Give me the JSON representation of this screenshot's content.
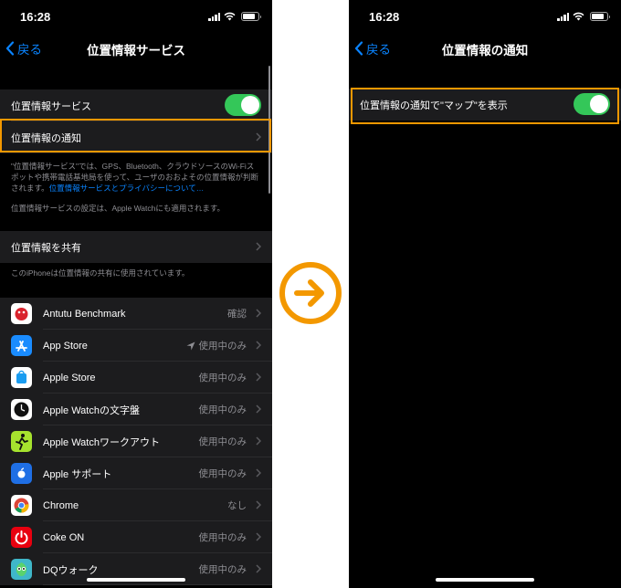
{
  "left": {
    "status": {
      "time": "16:28"
    },
    "nav": {
      "back": "戻る",
      "title": "位置情報サービス"
    },
    "location_services": {
      "label": "位置情報サービス",
      "enabled": true
    },
    "location_alerts": {
      "label": "位置情報の通知"
    },
    "footer1": {
      "text": "\"位置情報サービス\"では、GPS、Bluetooth、クラウドソースのWi-Fiスポットや携帯電話基地局を使って、ユーザのおおよその位置情報が判断されます。",
      "link": "位置情報サービスとプライバシーについて…"
    },
    "footer2": "位置情報サービスの設定は、Apple Watchにも適用されます。",
    "share": {
      "label": "位置情報を共有"
    },
    "footer3": "このiPhoneは位置情報の共有に使用されています。",
    "apps": [
      {
        "name": "Antutu Benchmark",
        "value": "確認",
        "icon": "antutu-icon",
        "color": "#ffffff"
      },
      {
        "name": "App Store",
        "value": "使用中のみ",
        "icon": "app-store-icon",
        "color": "#1a8cff",
        "arrow": true
      },
      {
        "name": "Apple Store",
        "value": "使用中のみ",
        "icon": "apple-store-icon",
        "color": "#ffffff"
      },
      {
        "name": "Apple Watchの文字盤",
        "value": "使用中のみ",
        "icon": "watch-face-icon",
        "color": "#ffffff"
      },
      {
        "name": "Apple Watchワークアウト",
        "value": "使用中のみ",
        "icon": "workout-icon",
        "color": "#a6e22e"
      },
      {
        "name": "Apple サポート",
        "value": "使用中のみ",
        "icon": "apple-support-icon",
        "color": "#1f6fe5"
      },
      {
        "name": "Chrome",
        "value": "なし",
        "icon": "chrome-icon",
        "color": "#ffffff"
      },
      {
        "name": "Coke ON",
        "value": "使用中のみ",
        "icon": "coke-on-icon",
        "color": "#e8000f"
      },
      {
        "name": "DQウォーク",
        "value": "使用中のみ",
        "icon": "dq-walk-icon",
        "color": "#3fb7c9"
      }
    ]
  },
  "right": {
    "status": {
      "time": "16:28"
    },
    "nav": {
      "back": "戻る",
      "title": "位置情報の通知"
    },
    "show_in_maps": {
      "label": "位置情報の通知で\"マップ\"を表示",
      "enabled": true
    }
  },
  "arrow_icon": "arrow-right-circle-icon",
  "accent": "#f39800"
}
